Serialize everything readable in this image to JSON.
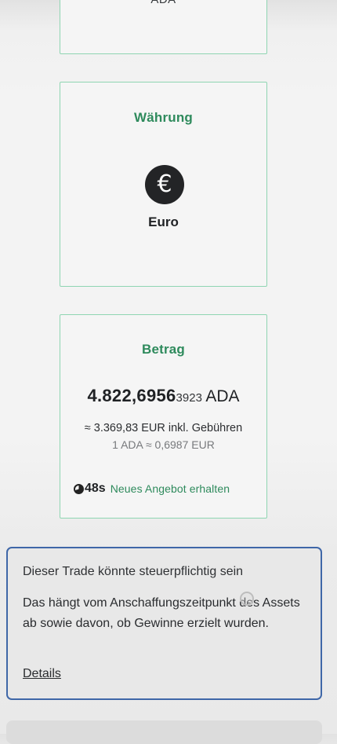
{
  "top_card": {
    "asset": "ADA"
  },
  "currency_card": {
    "title": "Währung",
    "icon": "euro-icon",
    "icon_glyph": "€",
    "name": "Euro"
  },
  "amount_card": {
    "title": "Betrag",
    "amount_main": "4.822,6956",
    "amount_small": "3923",
    "amount_unit": "ADA",
    "eur_value": "≈  3.369,83 EUR inkl. Gebühren",
    "rate": "1 ADA ≈ 0,6987 EUR",
    "timer_icon": "timer-icon",
    "timer_seconds": "48s",
    "timer_text": "Neues Angebot erhalten"
  },
  "tax_notice": {
    "title": "Dieser Trade könnte steuerpflichtig sein",
    "body": "Das hängt vom Anschaffungszeitpunkt des Assets ab sowie davon, ob Gewinne erzielt wurden.",
    "link": "Details"
  },
  "colors": {
    "accent_green": "#2e8a5c",
    "card_border": "#8fd5b2",
    "notice_border": "#3f67a8",
    "icon_bg": "#232426"
  }
}
